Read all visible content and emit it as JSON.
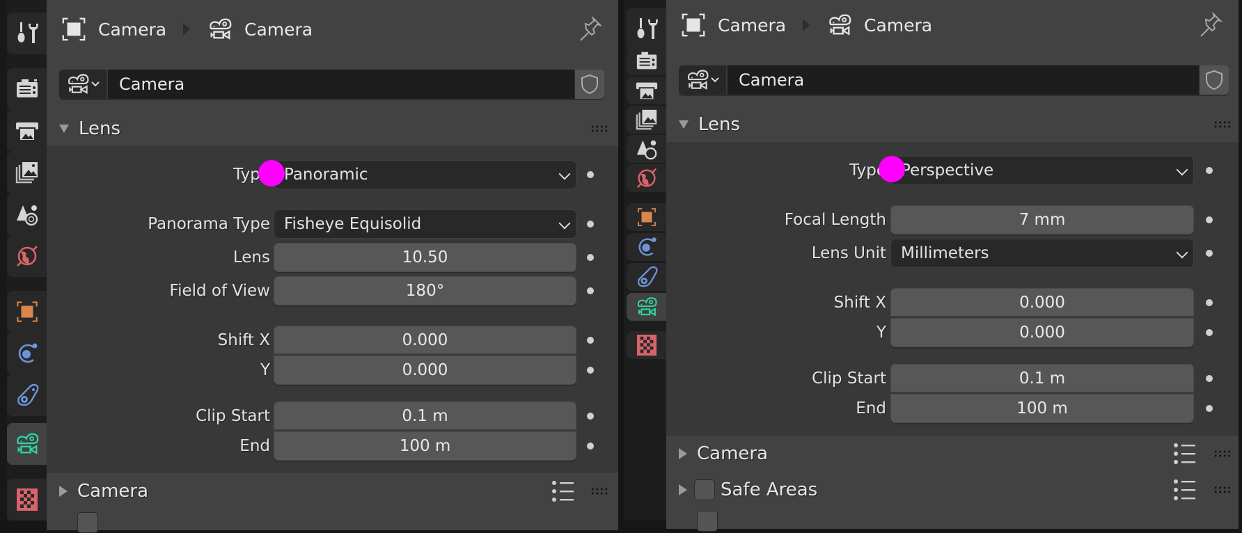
{
  "accent": {
    "active_tab": "#2fd6a3",
    "cursor_marker": "#ff00ff"
  },
  "left": {
    "breadcrumb": {
      "object": "Camera",
      "data": "Camera"
    },
    "datablock": {
      "name": "Camera"
    },
    "lens_panel": {
      "title": "Lens",
      "type": {
        "label": "Type",
        "value": "Panoramic"
      },
      "panorama_type": {
        "label": "Panorama Type",
        "value": "Fisheye Equisolid"
      },
      "lens": {
        "label": "Lens",
        "value": "10.50"
      },
      "fov": {
        "label": "Field of View",
        "value": "180°"
      },
      "shift_x": {
        "label": "Shift X",
        "value": "0.000"
      },
      "shift_y": {
        "label": "Y",
        "value": "0.000"
      },
      "clip_start": {
        "label": "Clip Start",
        "value": "0.1 m"
      },
      "clip_end": {
        "label": "End",
        "value": "100 m"
      }
    },
    "subpanels": [
      {
        "title": "Camera"
      }
    ]
  },
  "right": {
    "breadcrumb": {
      "object": "Camera",
      "data": "Camera"
    },
    "datablock": {
      "name": "Camera"
    },
    "lens_panel": {
      "title": "Lens",
      "type": {
        "label": "Type",
        "value": "Perspective"
      },
      "focal_length": {
        "label": "Focal Length",
        "value": "7 mm"
      },
      "lens_unit": {
        "label": "Lens Unit",
        "value": "Millimeters"
      },
      "shift_x": {
        "label": "Shift X",
        "value": "0.000"
      },
      "shift_y": {
        "label": "Y",
        "value": "0.000"
      },
      "clip_start": {
        "label": "Clip Start",
        "value": "0.1 m"
      },
      "clip_end": {
        "label": "End",
        "value": "100 m"
      }
    },
    "subpanels": [
      {
        "title": "Camera"
      },
      {
        "title": "Safe Areas"
      }
    ]
  },
  "tabs": [
    {
      "icon": "tool-icon"
    },
    {
      "icon": "render-icon"
    },
    {
      "icon": "output-icon"
    },
    {
      "icon": "view-layer-icon"
    },
    {
      "icon": "scene-icon"
    },
    {
      "icon": "world-icon"
    },
    {
      "icon": "object-icon"
    },
    {
      "icon": "physics-icon"
    },
    {
      "icon": "constraints-icon"
    },
    {
      "icon": "camera-data-icon",
      "active": true
    },
    {
      "icon": "texture-icon"
    }
  ]
}
